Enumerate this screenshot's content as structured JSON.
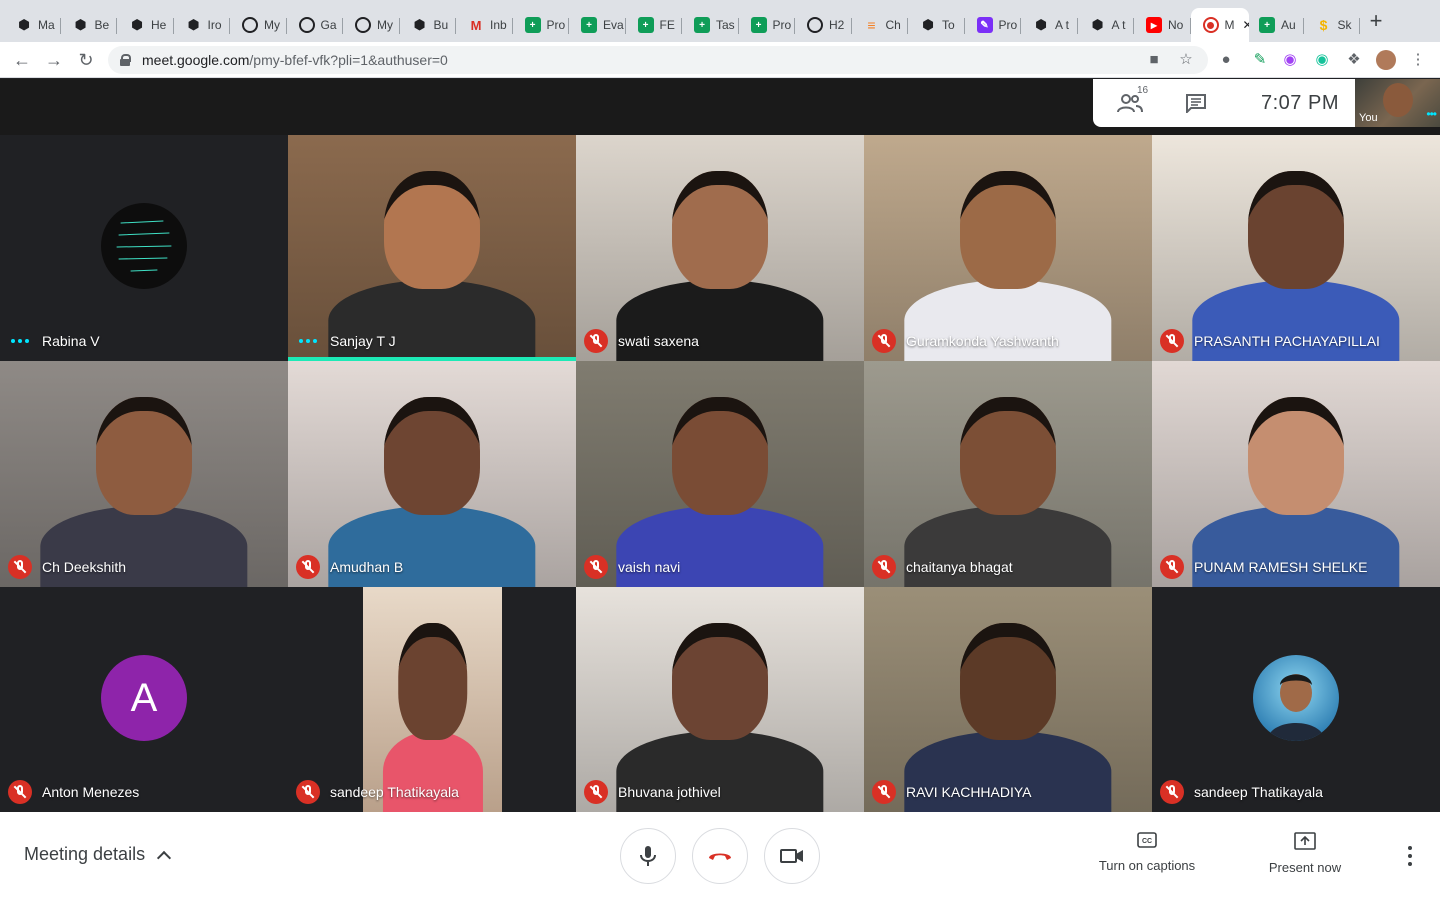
{
  "browser": {
    "tabs": [
      {
        "label": "Ma",
        "icon": "codepen-icon",
        "color": "#202124"
      },
      {
        "label": "Be",
        "icon": "codepen-icon",
        "color": "#202124"
      },
      {
        "label": "He",
        "icon": "codepen-icon",
        "color": "#202124"
      },
      {
        "label": "Iro",
        "icon": "codepen-icon",
        "color": "#202124"
      },
      {
        "label": "My",
        "icon": "globe-icon",
        "color": "#202124"
      },
      {
        "label": "Ga",
        "icon": "globe-icon",
        "color": "#202124"
      },
      {
        "label": "My",
        "icon": "globe-icon",
        "color": "#202124"
      },
      {
        "label": "Bu",
        "icon": "codepen-icon",
        "color": "#202124"
      },
      {
        "label": "Inb",
        "icon": "gmail-icon",
        "color": "#d93025"
      },
      {
        "label": "Pro",
        "icon": "sheets-icon",
        "color": "#0f9d58"
      },
      {
        "label": "Eva",
        "icon": "sheets-icon",
        "color": "#0f9d58"
      },
      {
        "label": "FE",
        "icon": "sheets-icon",
        "color": "#0f9d58"
      },
      {
        "label": "Tas",
        "icon": "sheets-icon",
        "color": "#0f9d58"
      },
      {
        "label": "Pro",
        "icon": "sheets-icon",
        "color": "#0f9d58"
      },
      {
        "label": "H2",
        "icon": "globe-icon",
        "color": "#202124"
      },
      {
        "label": "Ch",
        "icon": "stack-icon",
        "color": "#f48024"
      },
      {
        "label": "To",
        "icon": "codepen-icon",
        "color": "#202124"
      },
      {
        "label": "Pro",
        "icon": "pen-icon",
        "color": "#7b2ff7"
      },
      {
        "label": "A t",
        "icon": "codepen-icon",
        "color": "#202124"
      },
      {
        "label": "A t",
        "icon": "codepen-icon",
        "color": "#202124"
      },
      {
        "label": "No",
        "icon": "youtube-icon",
        "color": "#ff0000"
      },
      {
        "label": "M",
        "icon": "record-icon",
        "color": "#d93025"
      },
      {
        "label": "Au",
        "icon": "sheets-icon",
        "color": "#0f9d58"
      },
      {
        "label": "Sk",
        "icon": "dollar-icon",
        "color": "#f4b400"
      }
    ],
    "active_tab_index": 21,
    "url_host": "meet.google.com",
    "url_path": "/pmy-bfef-vfk?pli=1&authuser=0"
  },
  "meet": {
    "participant_count": "16",
    "time": "7:07  PM",
    "self_label": "You",
    "participants": [
      {
        "name": "Rabina V",
        "status": "speaking",
        "avatar": "quote-badge",
        "bg": "#202124"
      },
      {
        "name": "Sanjay T J",
        "status": "speaking",
        "active": true,
        "bg": "#8b6a4e",
        "skin": "#b27650",
        "shirt": "#2b2b2b"
      },
      {
        "name": "swati saxena",
        "status": "muted",
        "bg": "#dcd5cc",
        "skin": "#a06c4d",
        "shirt": "#1b1b1b"
      },
      {
        "name": "Guramkonda Yashwanth",
        "status": "muted",
        "bg": "#bfa98d",
        "skin": "#9c6a47",
        "shirt": "#e9e9ee"
      },
      {
        "name": "PRASANTH PACHAYAPILLAI",
        "status": "muted",
        "bg": "#ede6dc",
        "skin": "#6a4330",
        "shirt": "#3b5bb8"
      },
      {
        "name": "Ch Deekshith",
        "status": "muted",
        "bg": "#8f8a86",
        "skin": "#8e5c40",
        "shirt": "#3a3a48"
      },
      {
        "name": "Amudhan B",
        "status": "muted",
        "bg": "#e3dad6",
        "skin": "#6e4532",
        "shirt": "#2f6c9c"
      },
      {
        "name": "vaish navi",
        "status": "muted",
        "bg": "#807c70",
        "skin": "#7a4c35",
        "shirt": "#3c45b3"
      },
      {
        "name": "chaitanya bhagat",
        "status": "muted",
        "bg": "#9d9a8e",
        "skin": "#7c4f36",
        "shirt": "#3b3a3a"
      },
      {
        "name": "PUNAM RAMESH SHELKE",
        "status": "muted",
        "bg": "#e1d8d4",
        "skin": "#c58e70",
        "shirt": "#385b9c"
      },
      {
        "name": "Anton Menezes",
        "status": "muted",
        "avatar": "letter",
        "letter": "A",
        "bg": "#202124"
      },
      {
        "name": "sandeep Thatikayala",
        "status": "muted",
        "bg": "#202124",
        "inset": true,
        "skin": "#6b4330",
        "shirt": "#e8556a"
      },
      {
        "name": "Bhuvana jothivel",
        "status": "muted",
        "bg": "#e7e2dc",
        "skin": "#6c4433",
        "shirt": "#2a2a2a"
      },
      {
        "name": "RAVI KACHHADIYA",
        "status": "muted",
        "bg": "#9b8f78",
        "skin": "#5c3a27",
        "shirt": "#2a3350"
      },
      {
        "name": "sandeep Thatikayala",
        "status": "muted",
        "avatar": "photo",
        "bg": "#202124"
      }
    ]
  },
  "bottom": {
    "meeting_details": "Meeting details",
    "captions_label": "Turn on captions",
    "present_label": "Present now"
  },
  "colors": {
    "accent_speaking": "#1de9b6",
    "muted_red": "#d93025",
    "avatar_purple": "#8e24aa"
  }
}
